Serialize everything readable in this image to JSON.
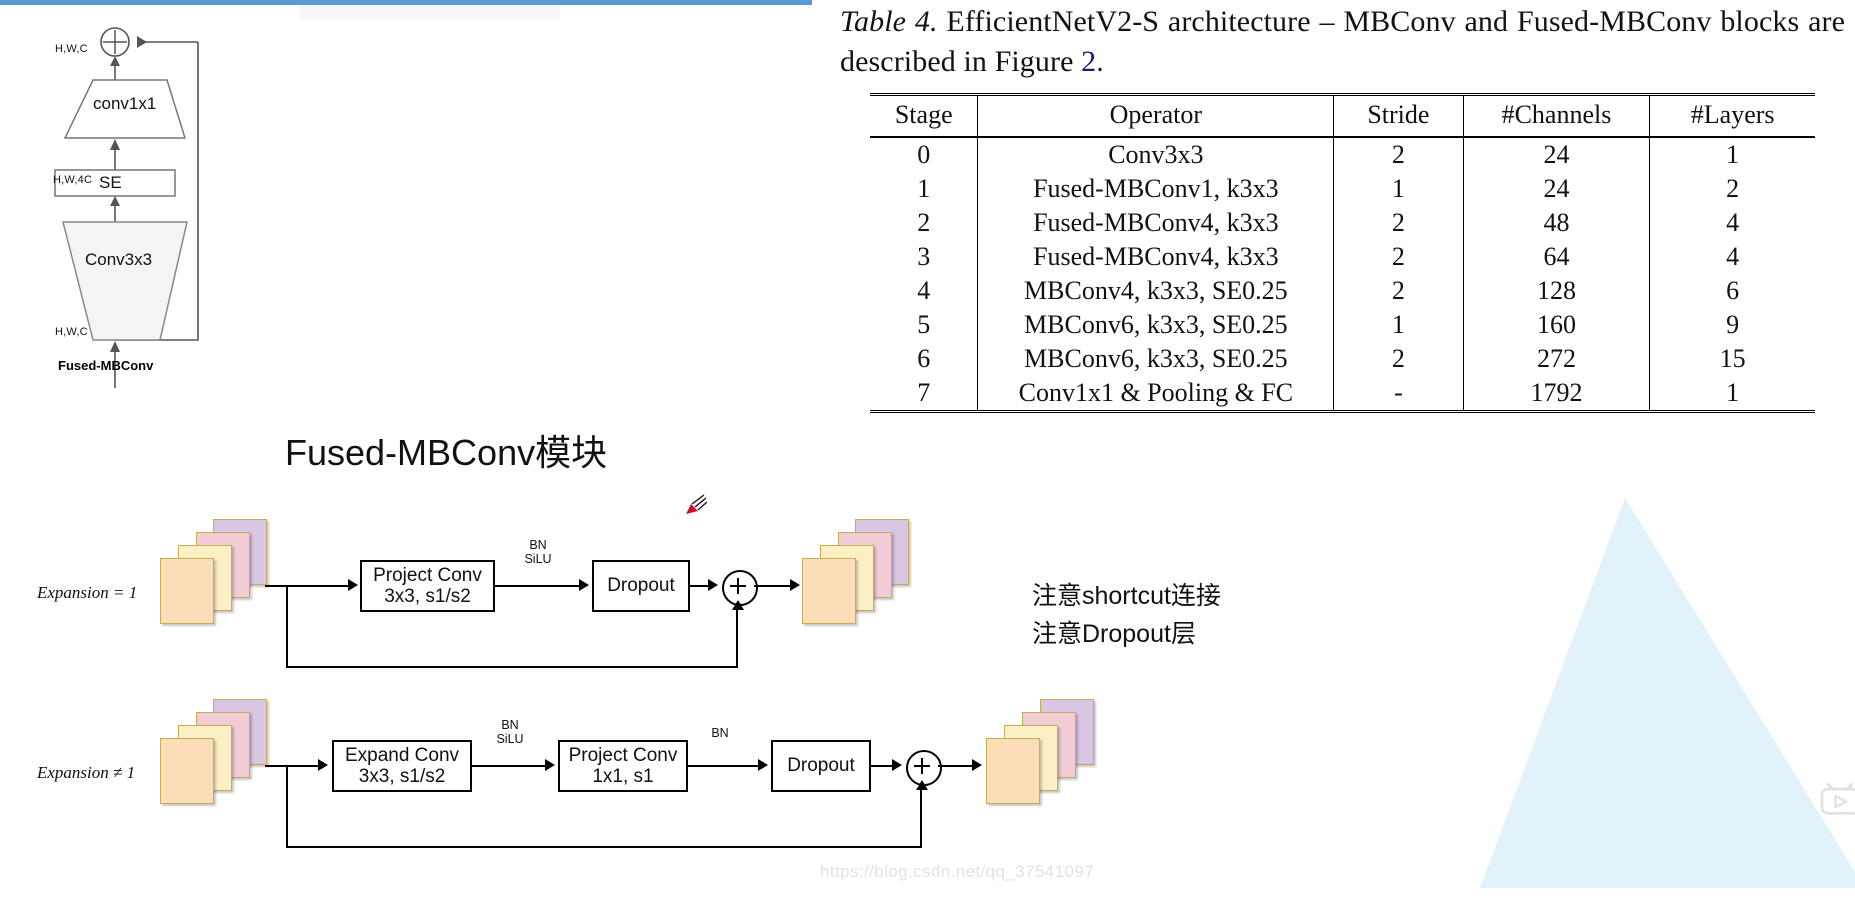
{
  "top_bar": {
    "color": "#5b9bd5"
  },
  "schematic": {
    "title": "Fused-MBConv",
    "blocks": [
      {
        "name": "conv1x1",
        "label": "conv1x1"
      },
      {
        "name": "se",
        "label": "SE"
      },
      {
        "name": "conv3x3",
        "label": "Conv3x3"
      }
    ],
    "tensor_labels": {
      "top": "H,W,C",
      "middle": "H,W,4C",
      "bottom": "H,W,C"
    }
  },
  "center_title": "Fused-MBConv模块",
  "paper": {
    "caption_prefix": "Table 4.",
    "caption_rest": " EfficientNetV2-S  architecture  –  MBConv  and  Fused-MBConv blocks are described in Figure ",
    "caption_link": "2",
    "caption_end": "."
  },
  "chart_data": {
    "type": "table",
    "title": "EfficientNetV2-S architecture",
    "columns": [
      "Stage",
      "Operator",
      "Stride",
      "#Channels",
      "#Layers"
    ],
    "rows": [
      [
        "0",
        "Conv3x3",
        "2",
        "24",
        "1"
      ],
      [
        "1",
        "Fused-MBConv1, k3x3",
        "1",
        "24",
        "2"
      ],
      [
        "2",
        "Fused-MBConv4, k3x3",
        "2",
        "48",
        "4"
      ],
      [
        "3",
        "Fused-MBConv4, k3x3",
        "2",
        "64",
        "4"
      ],
      [
        "4",
        "MBConv4, k3x3, SE0.25",
        "2",
        "128",
        "6"
      ],
      [
        "5",
        "MBConv6, k3x3, SE0.25",
        "1",
        "160",
        "9"
      ],
      [
        "6",
        "MBConv6, k3x3, SE0.25",
        "2",
        "272",
        "15"
      ],
      [
        "7",
        "Conv1x1 & Pooling & FC",
        "-",
        "1792",
        "1"
      ]
    ]
  },
  "flow_row1": {
    "expansion_label": "Expansion = 1",
    "blocks": [
      {
        "name": "project-conv",
        "line1": "Project Conv",
        "line2": "3x3, s1/s2"
      },
      {
        "name": "dropout",
        "line1": "Dropout",
        "line2": ""
      }
    ],
    "norm_labels": [
      {
        "line1": "BN",
        "line2": "SiLU"
      }
    ],
    "add_symbol": "+"
  },
  "flow_row2": {
    "expansion_label": "Expansion ≠ 1",
    "blocks": [
      {
        "name": "expand-conv",
        "line1": "Expand Conv",
        "line2": "3x3, s1/s2"
      },
      {
        "name": "project-conv",
        "line1": "Project Conv",
        "line2": "1x1, s1"
      },
      {
        "name": "dropout",
        "line1": "Dropout",
        "line2": ""
      }
    ],
    "norm_labels": [
      {
        "line1": "BN",
        "line2": "SiLU"
      },
      {
        "line1": "BN",
        "line2": ""
      }
    ],
    "add_symbol": "+"
  },
  "notes": {
    "line1": "注意shortcut连接",
    "line2": "注意Dropout层"
  },
  "watermark": "https://blog.csdn.net/qq_37541097",
  "feature_map_colors": [
    "#d9c6e3",
    "#f2ccd4",
    "#fbefc4",
    "#fbddb8"
  ]
}
